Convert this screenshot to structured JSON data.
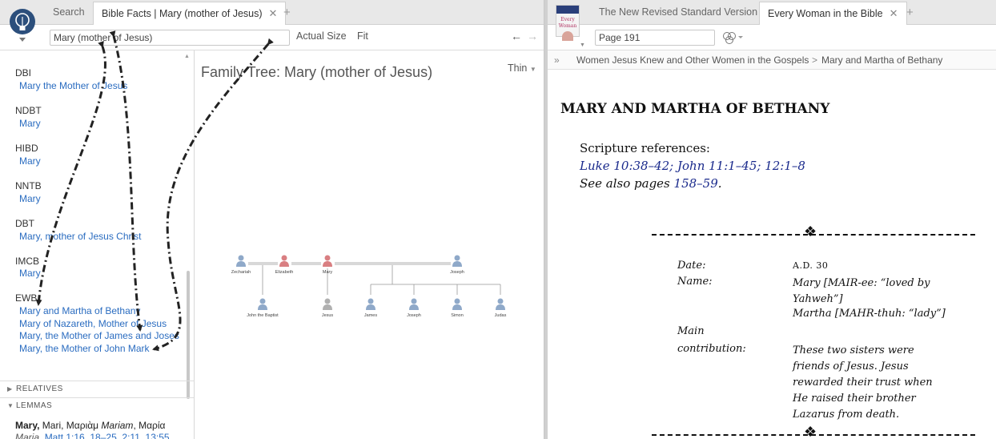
{
  "left_panel": {
    "tabs": [
      "Search",
      "Bible Facts | Mary (mother of Jesus)"
    ],
    "search_value": "Mary (mother of Jesus)",
    "toolbar": {
      "actual_size": "Actual Size",
      "fit": "Fit"
    },
    "sidebar": {
      "groups": [
        {
          "abbr": "DBI",
          "links": [
            "Mary the Mother of Jesus"
          ]
        },
        {
          "abbr": "NDBT",
          "links": [
            "Mary"
          ]
        },
        {
          "abbr": "HIBD",
          "links": [
            "Mary"
          ]
        },
        {
          "abbr": "NNTB",
          "links": [
            "Mary"
          ]
        },
        {
          "abbr": "DBT",
          "links": [
            "Mary, mother of Jesus Christ"
          ]
        },
        {
          "abbr": "IMCB",
          "links": [
            "Mary"
          ]
        },
        {
          "abbr": "EWB",
          "links": [
            "Mary and Martha of Bethany",
            "Mary of Nazareth, Mother of Jesus",
            "Mary, the Mother of James and Joses",
            "Mary, the Mother of John Mark"
          ]
        }
      ],
      "sections": [
        "RELATIVES",
        "LEMMAS"
      ],
      "lemma_line1": {
        "bold": "Mary,",
        "rest": " Mari, Μαριὰμ ",
        "italic": "Mariam",
        "rest2": ", Μαρία"
      },
      "lemma_line2": {
        "italic": "Maria",
        "refs": "Matt 1:16, 18–25, 2:11, 13:55"
      }
    },
    "family_tree": {
      "title": "Family Tree: Mary (mother of Jesus)",
      "style_option": "Thin",
      "people": [
        {
          "name": "Zechariah",
          "sex": "male",
          "gen": 0
        },
        {
          "name": "Elizabeth",
          "sex": "female",
          "gen": 0
        },
        {
          "name": "Mary",
          "sex": "female",
          "gen": 0
        },
        {
          "name": "Joseph",
          "sex": "male",
          "gen": 0
        },
        {
          "name": "John the Baptist",
          "sex": "male",
          "gen": 1
        },
        {
          "name": "Jesus",
          "sex": "unknown",
          "gen": 1
        },
        {
          "name": "James",
          "sex": "male",
          "gen": 1
        },
        {
          "name": "Joseph",
          "sex": "male",
          "gen": 1
        },
        {
          "name": "Simon",
          "sex": "male",
          "gen": 1
        },
        {
          "name": "Judas",
          "sex": "male",
          "gen": 1
        }
      ]
    }
  },
  "right_panel": {
    "tabs": [
      "The New Revised Standard Version",
      "Every Woman in the Bible"
    ],
    "page_value": "Page 191",
    "breadcrumb": [
      "Women Jesus Knew and Other Women in the Gospels",
      "Mary and Martha of Bethany"
    ],
    "book_cover_text": "Every Woman",
    "document": {
      "heading": "MARY AND MARTHA OF BETHANY",
      "scripture_label": "Scripture references:",
      "scripture_refs": "Luke 10:38–42; John 11:1–45; 12:1–8",
      "see_also_prefix": "See also pages ",
      "see_also_link": "158–59",
      "see_also_suffix": ".",
      "facts": [
        {
          "label": "Date:",
          "value": "A.D. 30"
        },
        {
          "label": "Name:",
          "value": "Mary [MAIR-ee: “loved by Yahweh”]"
        },
        {
          "label": "",
          "value": "Martha [MAHR-thuh: “lady”]"
        },
        {
          "label": "Main",
          "value": ""
        },
        {
          "label": "contribution:",
          "value": "These two sisters were friends of Jesus. Jesus rewarded their trust when He raised their brother Lazarus from death."
        }
      ]
    }
  },
  "colors": {
    "link": "#2a6cc0",
    "male": "#8fa9c9",
    "female": "#d97f82",
    "unknown": "#b0b0b0",
    "doc_link": "#1a2a8c"
  }
}
